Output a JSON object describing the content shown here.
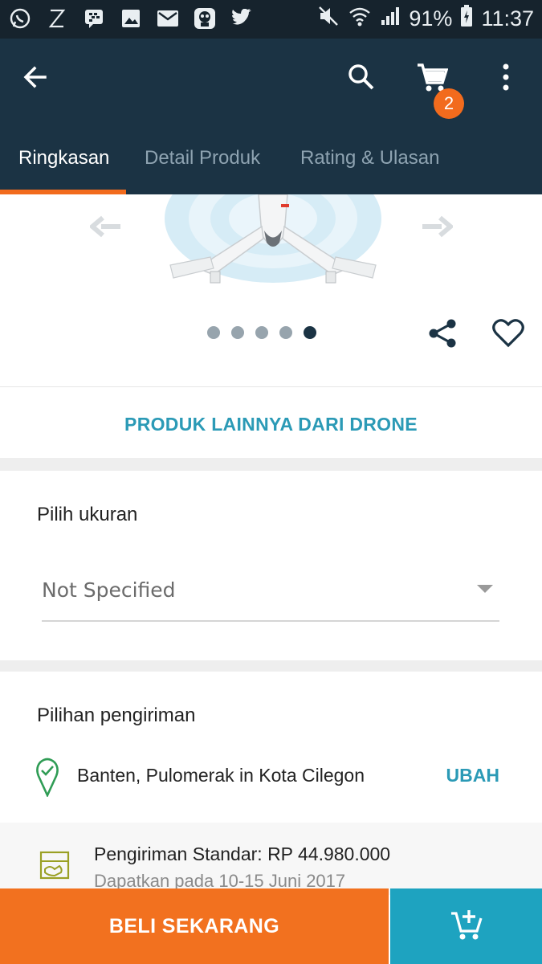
{
  "status_bar": {
    "battery": "91%",
    "time": "11:37",
    "icons": [
      "whatsapp-icon",
      "z-app-icon",
      "bbm-icon",
      "gallery-icon",
      "gmail-icon",
      "mascot-app-icon",
      "twitter-icon",
      "mute-icon",
      "wifi-icon",
      "signal-icon",
      "battery-icon"
    ]
  },
  "app_bar": {
    "cart_count": "2",
    "icons": [
      "back-arrow-icon",
      "search-icon",
      "cart-icon",
      "more-vert-icon"
    ]
  },
  "tabs": [
    {
      "label": "Ringkasan",
      "active": true
    },
    {
      "label": "Detail Produk",
      "active": false
    },
    {
      "label": "Rating & Ulasan",
      "active": false
    }
  ],
  "carousel": {
    "image_count": 5,
    "active_index": 4
  },
  "more_from_seller": "PRODUK LAINNYA DARI DRONE",
  "size": {
    "title": "Pilih ukuran",
    "selected": "Not Specified"
  },
  "shipping": {
    "title": "Pilihan pengiriman",
    "address": "Banten, Pulomerak in Kota Cilegon",
    "change_label": "UBAH",
    "option_title": "Pengiriman Standar: RP 44.980.000",
    "option_eta": "Dapatkan pada 10-15 Juni 2017"
  },
  "bottom_bar": {
    "buy_now": "BELI SEKARANG"
  },
  "colors": {
    "status_bar": "#16232d",
    "app_bar": "#1b3344",
    "accent_orange": "#f26b1d",
    "link_teal": "#2b9ab6",
    "cart_button": "#1ea3c0"
  }
}
